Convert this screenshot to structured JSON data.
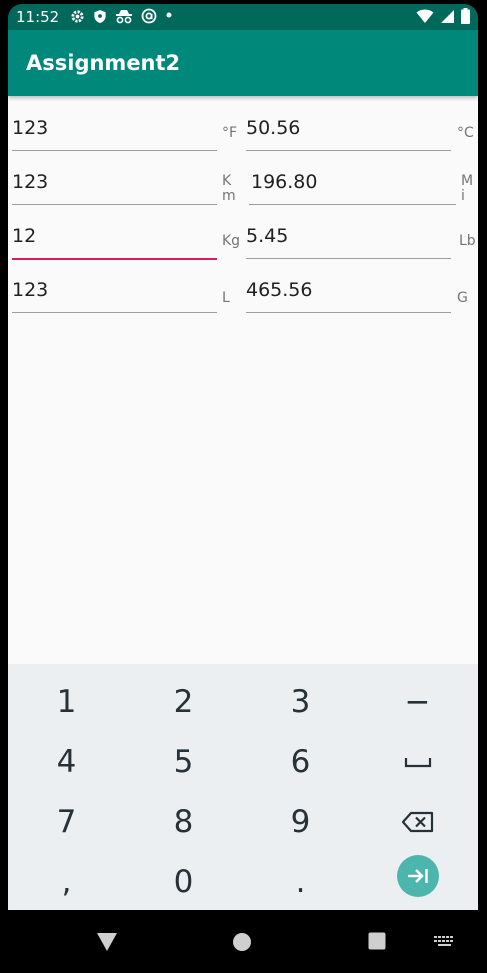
{
  "status_bar": {
    "time": "11:52",
    "left_icons": [
      "gear-icon",
      "shield-icon",
      "incognito-icon",
      "at-sign-icon",
      "dot-icon"
    ],
    "right_icons": [
      "wifi-icon",
      "signal-icon",
      "battery-icon"
    ]
  },
  "app_bar": {
    "title": "Assignment2"
  },
  "converter": {
    "rows": [
      {
        "input": "123",
        "from_unit": "°F",
        "output": "50.56",
        "to_unit": "°C",
        "focused": false
      },
      {
        "input": "123",
        "from_unit": "K\nm",
        "output": "196.80",
        "to_unit": "M\ni",
        "focused": false
      },
      {
        "input": "12",
        "from_unit": "Kg",
        "output": "5.45",
        "to_unit": "Lb",
        "focused": true
      },
      {
        "input": "123",
        "from_unit": "L",
        "output": "465.56",
        "to_unit": "G",
        "focused": false
      }
    ]
  },
  "keyboard": {
    "keys": [
      [
        "1",
        "2",
        "3",
        "−"
      ],
      [
        "4",
        "5",
        "6",
        "␣"
      ],
      [
        "7",
        "8",
        "9",
        "backspace-icon"
      ],
      [
        ",",
        "0",
        ".",
        "next-icon"
      ]
    ]
  },
  "nav_bar": {
    "icons": [
      "back-icon",
      "home-icon",
      "recents-icon",
      "keyboard-icon"
    ]
  },
  "colors": {
    "status_bar": "#00695c",
    "app_bar": "#00897b",
    "focus_underline": "#d81b60",
    "action_key": "#4db6ac"
  }
}
